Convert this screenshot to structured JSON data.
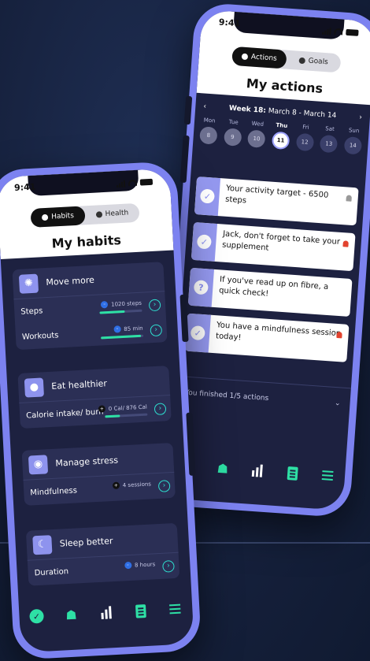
{
  "habits_phone": {
    "status_time": "9:41",
    "tabs": {
      "active": "Habits",
      "inactive": "Health"
    },
    "title": "My habits",
    "cards": [
      {
        "title": "Move more",
        "icon": "running-icon",
        "rows": [
          {
            "label": "Steps",
            "value": "1020 steps",
            "progress": 0.6
          },
          {
            "label": "Workouts",
            "value": "85 min",
            "progress": 0.95
          }
        ]
      },
      {
        "title": "Eat healthier",
        "icon": "plate-icon",
        "rows": [
          {
            "label": "Calorie intake/ burn",
            "value": "0 Cal/ 876 Cal",
            "progress": 0.35
          }
        ]
      },
      {
        "title": "Manage stress",
        "icon": "head-icon",
        "rows": [
          {
            "label": "Mindfulness",
            "value": "4 sessions"
          }
        ]
      },
      {
        "title": "Sleep better",
        "icon": "moon-icon",
        "rows": [
          {
            "label": "Duration",
            "value": "8 hours"
          }
        ]
      }
    ]
  },
  "actions_phone": {
    "status_time": "9:41",
    "tabs": {
      "active": "Actions",
      "inactive": "Goals"
    },
    "title": "My actions",
    "week_label": "Week 18:",
    "week_range": "March 8 - March 14",
    "days": [
      {
        "name": "Mon",
        "num": "8"
      },
      {
        "name": "Tue",
        "num": "9"
      },
      {
        "name": "Wed",
        "num": "10"
      },
      {
        "name": "Thu",
        "num": "11"
      },
      {
        "name": "Fri",
        "num": "12"
      },
      {
        "name": "Sat",
        "num": "13"
      },
      {
        "name": "Sun",
        "num": "14"
      }
    ],
    "actions": [
      {
        "text": "Your activity target - 6500 steps",
        "mark": "✓",
        "alert": false
      },
      {
        "text": "Jack, don't forget to take your supplement",
        "mark": "✓",
        "alert": true
      },
      {
        "text": "If you've read up on fibre, a quick check!",
        "mark": "?",
        "alert": false
      },
      {
        "text": "You have a mindfulness session today!",
        "mark": "✓",
        "alert": true
      }
    ],
    "finished": "You finished 1/5 actions"
  },
  "colors": {
    "accent": "#2ee0a5",
    "frame": "#7c82f0",
    "card": "#2b2f55"
  }
}
